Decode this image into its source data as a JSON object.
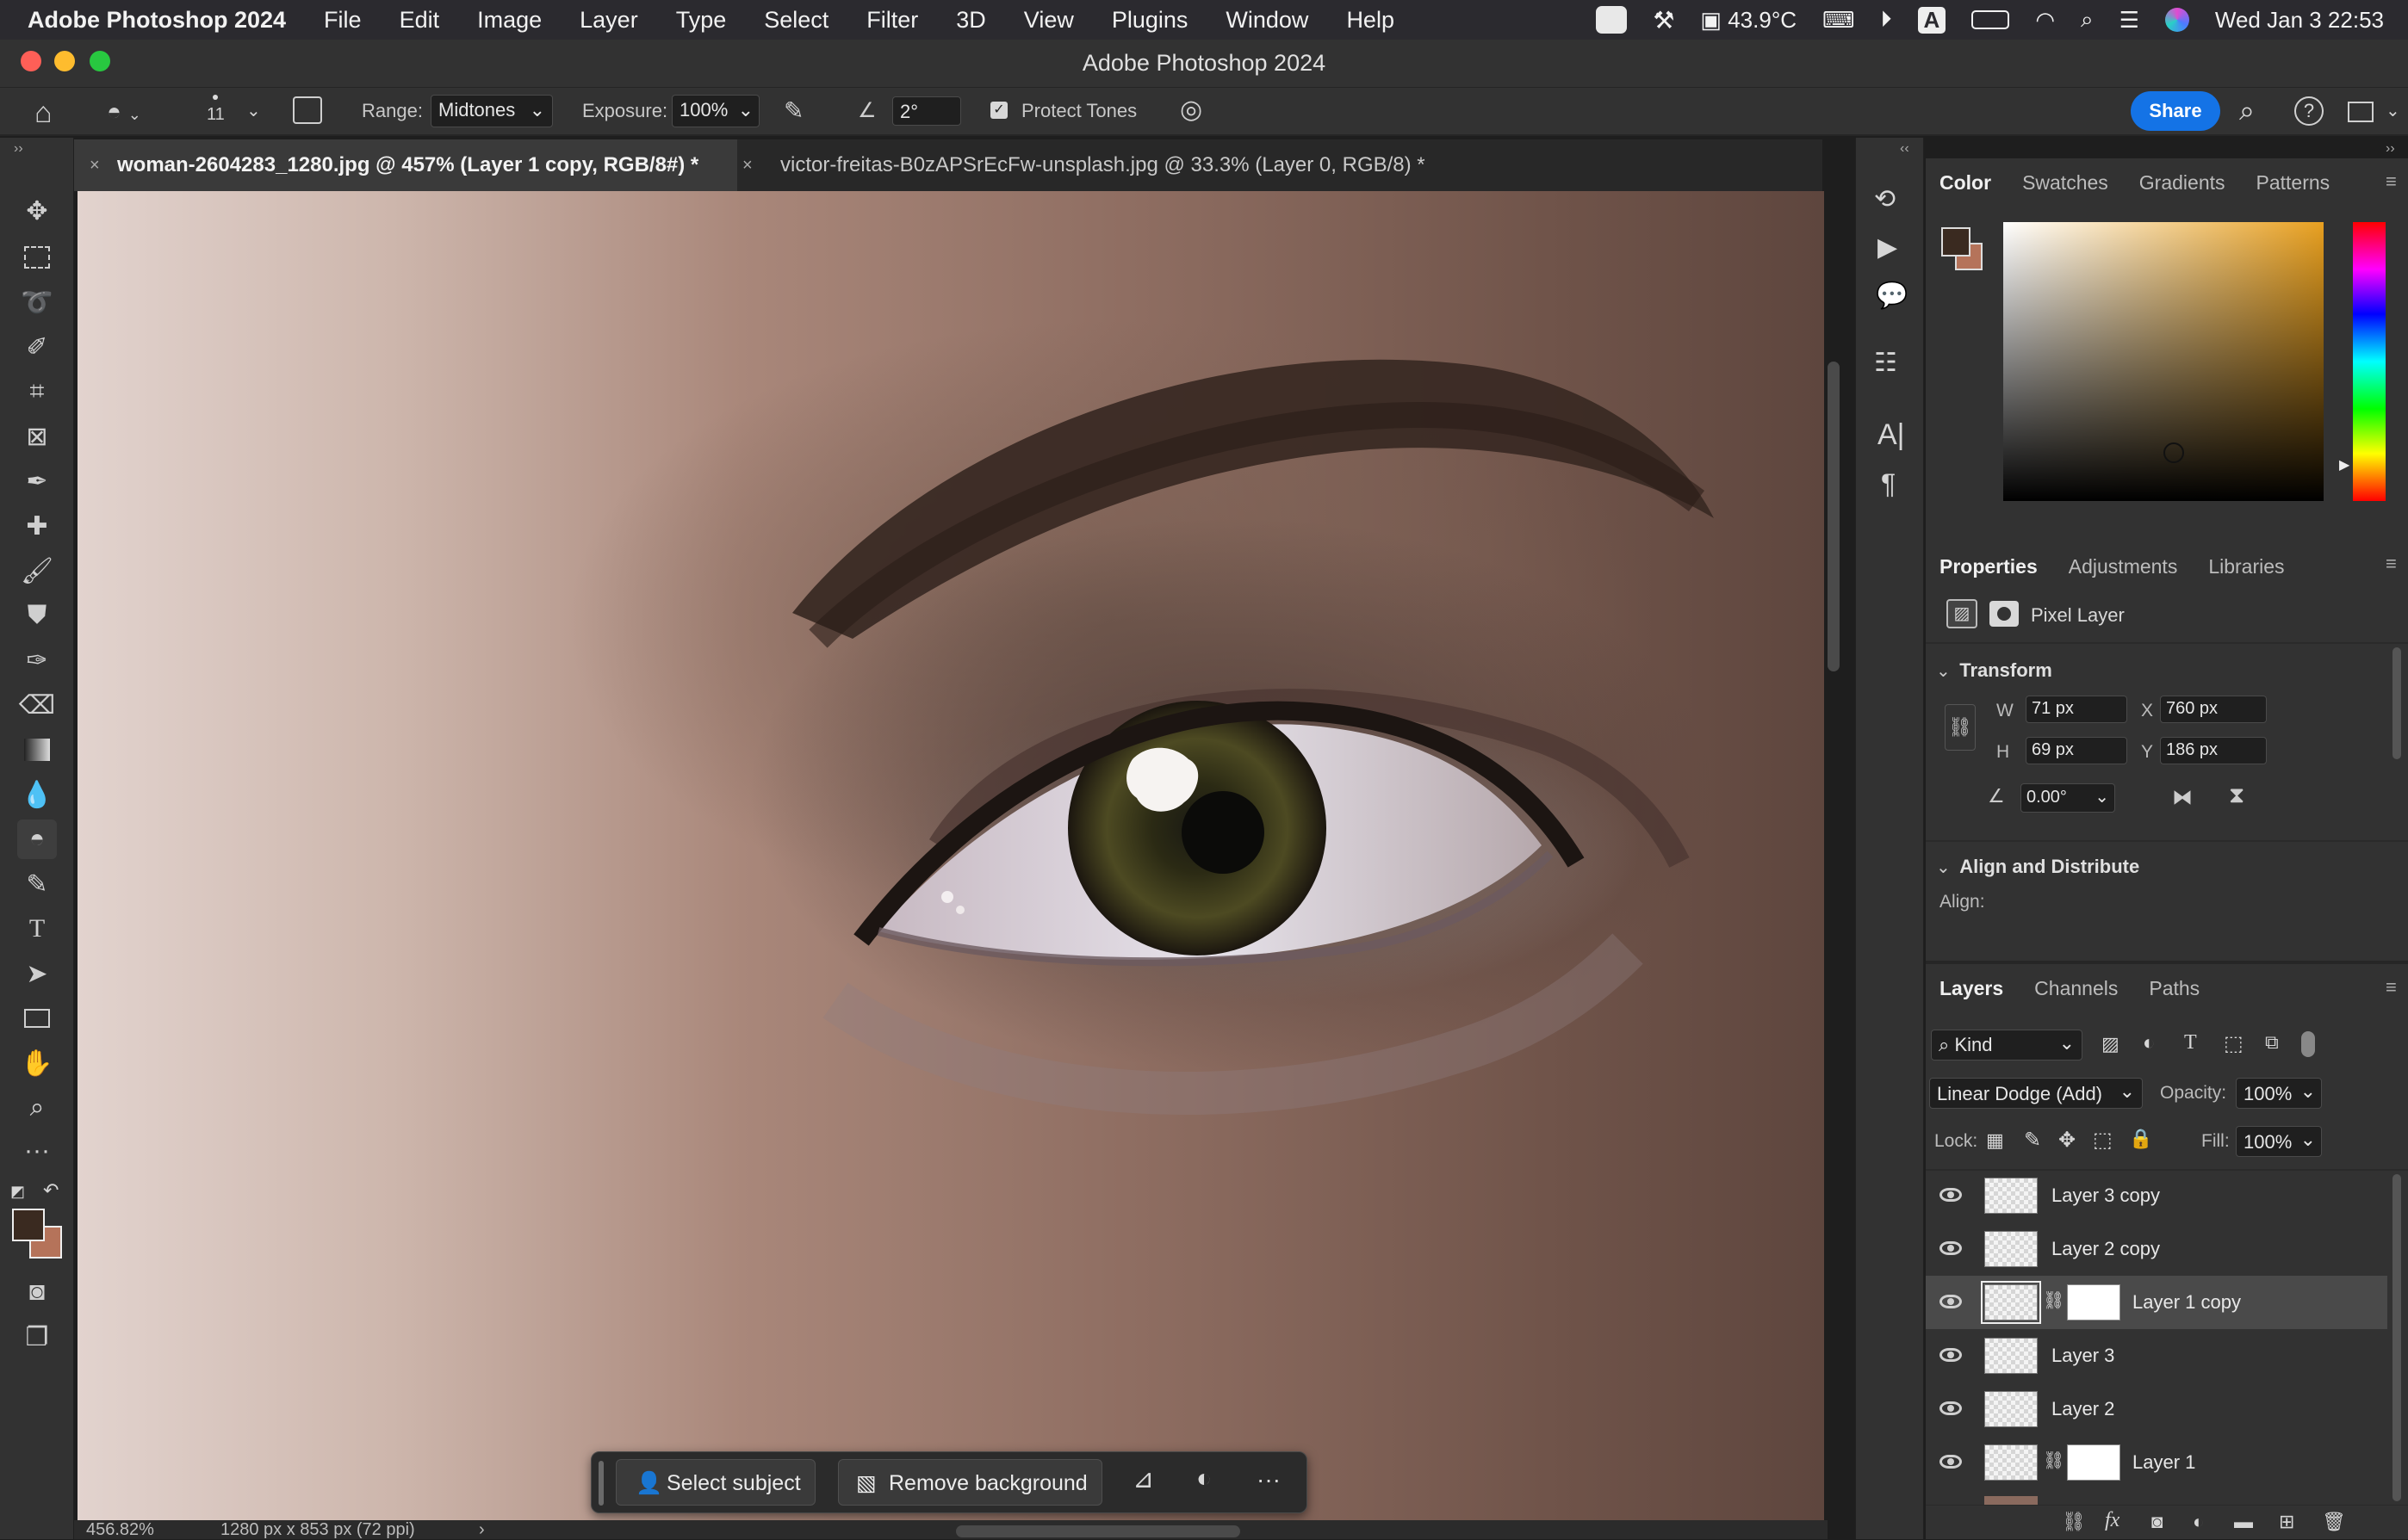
{
  "menubar": {
    "app": "Adobe Photoshop 2024",
    "items": [
      "File",
      "Edit",
      "Image",
      "Layer",
      "Type",
      "Select",
      "Filter",
      "3D",
      "View",
      "Plugins",
      "Window",
      "Help"
    ],
    "temperature": "43.9°C",
    "input_indicator": "A",
    "datetime": "Wed Jan 3  22:53"
  },
  "window": {
    "title": "Adobe Photoshop 2024"
  },
  "options": {
    "brush_size": "11",
    "range_label": "Range:",
    "range_value": "Midtones",
    "exposure_label": "Exposure:",
    "exposure_value": "100%",
    "angle_value": "2°",
    "protect_tones": "Protect Tones",
    "share": "Share"
  },
  "tabs": [
    {
      "label": "woman-2604283_1280.jpg @ 457% (Layer 1 copy, RGB/8#) *"
    },
    {
      "label": "victor-freitas-B0zAPSrEcFw-unsplash.jpg @ 33.3% (Layer 0, RGB/8) *"
    }
  ],
  "statusbar": {
    "zoom": "456.82%",
    "dimensions": "1280 px x 853 px (72 ppi)",
    "arrow": "›"
  },
  "color_panel": {
    "tabs": [
      "Color",
      "Swatches",
      "Gradients",
      "Patterns"
    ],
    "fg": "#3a2a20",
    "bg": "#b5735a"
  },
  "properties": {
    "tabs": [
      "Properties",
      "Adjustments",
      "Libraries"
    ],
    "kind": "Pixel Layer",
    "transform_title": "Transform",
    "w_label": "W",
    "w": "71 px",
    "x_label": "X",
    "x": "760 px",
    "h_label": "H",
    "h": "69 px",
    "y_label": "Y",
    "y": "186 px",
    "angle": "0.00°",
    "align_title": "Align and Distribute",
    "align_label": "Align:"
  },
  "layers_panel": {
    "tabs": [
      "Layers",
      "Channels",
      "Paths"
    ],
    "filter": "Kind",
    "blend_mode": "Linear Dodge (Add)",
    "opacity_label": "Opacity:",
    "opacity": "100%",
    "lock_label": "Lock:",
    "fill_label": "Fill:",
    "fill": "100%",
    "layers": [
      {
        "name": "Layer 3 copy",
        "mask": false,
        "selected": false
      },
      {
        "name": "Layer 2 copy",
        "mask": false,
        "selected": false
      },
      {
        "name": "Layer 1 copy",
        "mask": true,
        "selected": true
      },
      {
        "name": "Layer 3",
        "mask": false,
        "selected": false
      },
      {
        "name": "Layer 2",
        "mask": false,
        "selected": false
      },
      {
        "name": "Layer 1",
        "mask": true,
        "selected": false
      }
    ],
    "footer_fx": "fx"
  },
  "context_bar": {
    "select_subject": "Select subject",
    "remove_background": "Remove background",
    "more": "···"
  }
}
